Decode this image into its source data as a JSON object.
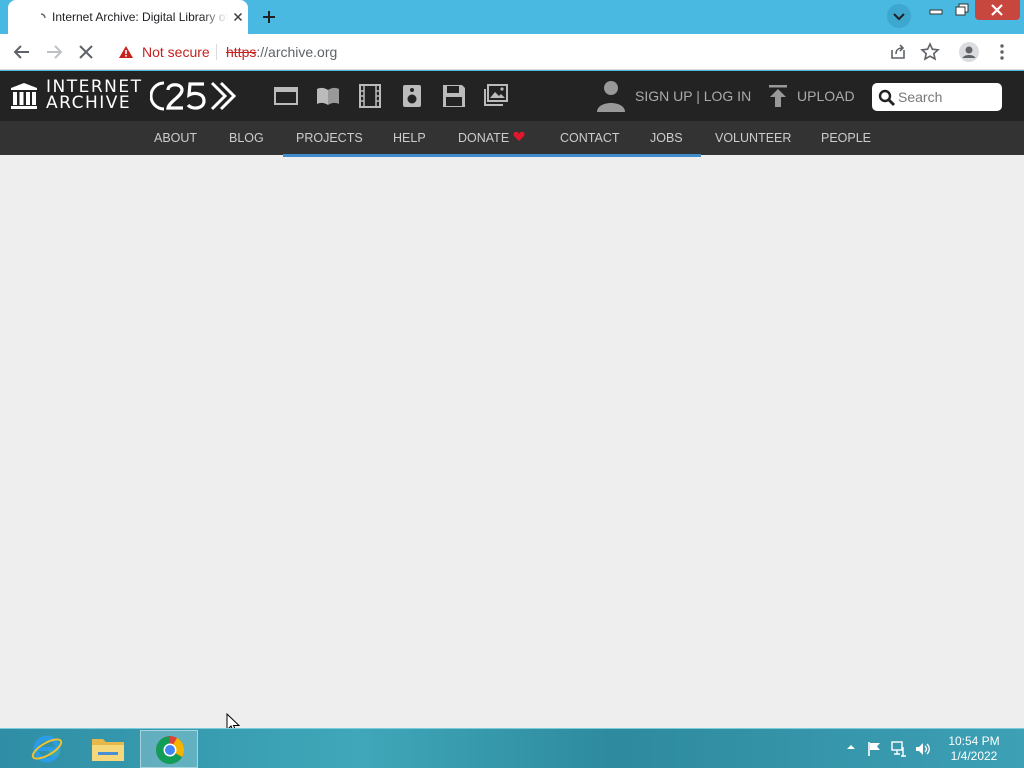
{
  "browser": {
    "tab_title": "Internet Archive: Digital Library of Free & Borrowable Books, Movies, Music & Wayback Machine",
    "security_label": "Not secure",
    "url_scheme": "https",
    "url_rest": "://archive.org"
  },
  "ia": {
    "logo_line1": "INTERNET",
    "logo_line2": "ARCHIVE",
    "media_icons": [
      "web-icon",
      "texts-icon",
      "video-icon",
      "audio-icon",
      "software-icon",
      "images-icon"
    ],
    "signup_label": "SIGN UP | LOG IN",
    "upload_label": "UPLOAD",
    "search_placeholder": "Search",
    "nav": [
      {
        "label": "ABOUT"
      },
      {
        "label": "BLOG"
      },
      {
        "label": "PROJECTS"
      },
      {
        "label": "HELP"
      },
      {
        "label": "DONATE"
      },
      {
        "label": "CONTACT"
      },
      {
        "label": "JOBS"
      },
      {
        "label": "VOLUNTEER"
      },
      {
        "label": "PEOPLE"
      }
    ]
  },
  "taskbar": {
    "apps": [
      "internet-explorer-icon",
      "file-explorer-icon",
      "chrome-icon"
    ],
    "time": "10:54 PM",
    "date": "1/4/2022"
  },
  "colors": {
    "header_bg": "#232323",
    "nav_bg": "#333333",
    "nav_underline": "#428bca",
    "insecure_red": "#c5221f",
    "tabstrip": "#49b9e1"
  }
}
